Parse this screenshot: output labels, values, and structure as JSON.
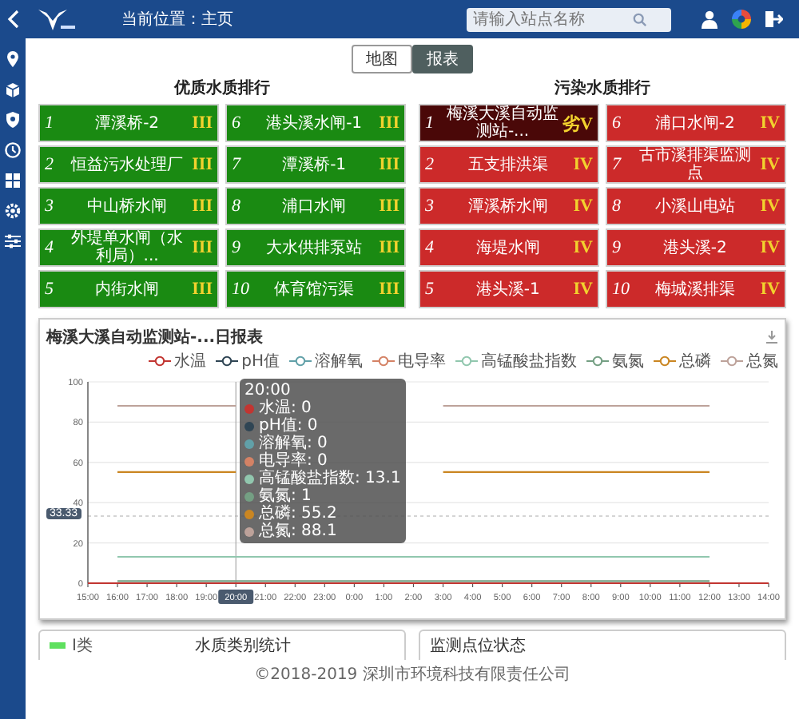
{
  "header": {
    "breadcrumb": "当前位置：主页",
    "search": {
      "placeholder": "请输入站点名称"
    }
  },
  "view_toggle": [
    {
      "label": "地图",
      "selected": false
    },
    {
      "label": "报表",
      "selected": true
    }
  ],
  "good_ranking": {
    "title": "优质水质排行",
    "items": [
      {
        "rank": "1",
        "name": "潭溪桥-2",
        "grade": "III",
        "selected": false
      },
      {
        "rank": "2",
        "name": "恒益污水处理厂",
        "grade": "III",
        "selected": false
      },
      {
        "rank": "3",
        "name": "中山桥水闸",
        "grade": "III",
        "selected": false
      },
      {
        "rank": "4",
        "name": "外堤单水闸（水利局）...",
        "grade": "III",
        "selected": false
      },
      {
        "rank": "5",
        "name": "内街水闸",
        "grade": "III",
        "selected": false
      },
      {
        "rank": "6",
        "name": "港头溪水闸-1",
        "grade": "III",
        "selected": false
      },
      {
        "rank": "7",
        "name": "潭溪桥-1",
        "grade": "III",
        "selected": false
      },
      {
        "rank": "8",
        "name": "浦口水闸",
        "grade": "III",
        "selected": false
      },
      {
        "rank": "9",
        "name": "大水供排泵站",
        "grade": "III",
        "selected": false
      },
      {
        "rank": "10",
        "name": "体育馆污渠",
        "grade": "III",
        "selected": false
      }
    ]
  },
  "bad_ranking": {
    "title": "污染水质排行",
    "items": [
      {
        "rank": "1",
        "name": "梅溪大溪自动监测站-...",
        "grade": "劣V",
        "selected": true
      },
      {
        "rank": "2",
        "name": "五支排洪渠",
        "grade": "IV",
        "selected": false
      },
      {
        "rank": "3",
        "name": "潭溪桥水闸",
        "grade": "IV",
        "selected": false
      },
      {
        "rank": "4",
        "name": "海堤水闸",
        "grade": "IV",
        "selected": false
      },
      {
        "rank": "5",
        "name": "港头溪-1",
        "grade": "IV",
        "selected": false
      },
      {
        "rank": "6",
        "name": "浦口水闸-2",
        "grade": "IV",
        "selected": false
      },
      {
        "rank": "7",
        "name": "古市溪排渠监测点",
        "grade": "IV",
        "selected": false
      },
      {
        "rank": "8",
        "name": "小溪山电站",
        "grade": "IV",
        "selected": false
      },
      {
        "rank": "9",
        "name": "港头溪-2",
        "grade": "IV",
        "selected": false
      },
      {
        "rank": "10",
        "name": "梅城溪排渠",
        "grade": "IV",
        "selected": false
      }
    ]
  },
  "chart_panel": {
    "title": "梅溪大溪自动监测站-...日报表",
    "tooltip": {
      "title": "20:00",
      "items": [
        {
          "text": "水温: 0",
          "color": "#c23531"
        },
        {
          "text": "pH值: 0",
          "color": "#2f4554"
        },
        {
          "text": "溶解氧: 0",
          "color": "#61a0a8"
        },
        {
          "text": "电导率: 0",
          "color": "#d48265"
        },
        {
          "text": "高锰酸盐指数: 13.1",
          "color": "#91c7ae"
        },
        {
          "text": "氨氮: 1",
          "color": "#749f83"
        },
        {
          "text": "总磷: 55.2",
          "color": "#ca8622"
        },
        {
          "text": "总氮: 88.1",
          "color": "#bda29a"
        }
      ]
    },
    "chart_data": {
      "type": "line",
      "categories": [
        "15:00",
        "16:00",
        "17:00",
        "18:00",
        "19:00",
        "20:00",
        "21:00",
        "22:00",
        "23:00",
        "0:00",
        "1:00",
        "2:00",
        "3:00",
        "4:00",
        "5:00",
        "6:00",
        "7:00",
        "8:00",
        "9:00",
        "10:00",
        "11:00",
        "12:00",
        "13:00",
        "14:00"
      ],
      "ylim": [
        0,
        100
      ],
      "grid": true,
      "ref_lines": [
        {
          "axis": "y",
          "value": 33.33,
          "label": "33.33"
        },
        {
          "axis": "x",
          "value": "20:00"
        }
      ],
      "yticks": [
        0,
        20,
        40,
        60,
        80,
        100
      ],
      "series": [
        {
          "name": "水温",
          "color": "#c23531",
          "values": [
            0,
            0,
            0,
            0,
            0,
            0,
            0,
            0,
            0,
            0,
            0,
            0,
            0,
            0,
            0,
            0,
            0,
            0,
            0,
            0,
            0,
            0,
            0,
            0
          ]
        },
        {
          "name": "pH值",
          "color": "#2f4554",
          "values": [
            null,
            null,
            null,
            null,
            null,
            null,
            null,
            null,
            null,
            null,
            null,
            null,
            null,
            null,
            null,
            null,
            null,
            null,
            null,
            null,
            null,
            null,
            null,
            null
          ]
        },
        {
          "name": "溶解氧",
          "color": "#61a0a8",
          "values": [
            null,
            null,
            null,
            null,
            null,
            null,
            null,
            null,
            null,
            null,
            null,
            null,
            null,
            null,
            null,
            null,
            null,
            null,
            null,
            null,
            null,
            null,
            null,
            null
          ]
        },
        {
          "name": "电导率",
          "color": "#d48265",
          "values": [
            null,
            null,
            null,
            null,
            null,
            null,
            null,
            null,
            null,
            null,
            null,
            null,
            null,
            null,
            null,
            null,
            null,
            null,
            null,
            null,
            null,
            null,
            null,
            null
          ]
        },
        {
          "name": "高锰酸盐指数",
          "color": "#91c7ae",
          "values": [
            null,
            13.1,
            13.1,
            13.1,
            13.1,
            13.1,
            13.1,
            13.1,
            13.1,
            13.1,
            13.1,
            13.1,
            13.1,
            13.1,
            13.1,
            13.1,
            13.1,
            13.1,
            13.1,
            13.1,
            13.1,
            13.1,
            null,
            null
          ]
        },
        {
          "name": "氨氮",
          "color": "#749f83",
          "values": [
            null,
            1,
            1,
            1,
            1,
            1,
            1,
            1,
            1,
            1,
            1,
            1,
            1,
            1,
            1,
            1,
            1,
            1,
            1,
            1,
            1,
            1,
            null,
            null
          ]
        },
        {
          "name": "总磷",
          "color": "#ca8622",
          "values": [
            null,
            55.2,
            55.2,
            55.2,
            55.2,
            55.2,
            null,
            null,
            null,
            null,
            null,
            null,
            55.2,
            55.2,
            55.2,
            55.2,
            55.2,
            55.2,
            55.2,
            55.2,
            55.2,
            55.2,
            null,
            null
          ]
        },
        {
          "name": "总氮",
          "color": "#bda29a",
          "values": [
            null,
            88.1,
            88.1,
            88.1,
            88.1,
            88.1,
            null,
            null,
            null,
            null,
            null,
            null,
            88.1,
            88.1,
            88.1,
            88.1,
            88.1,
            88.1,
            88.1,
            88.1,
            88.1,
            88.1,
            null,
            null
          ]
        }
      ]
    }
  },
  "bottom_cards": [
    {
      "label": "I类",
      "title": "水质类别统计"
    },
    {
      "title": "监测点位状态"
    }
  ],
  "footer": "©2018-2019 深圳市环境科技有限责任公司"
}
